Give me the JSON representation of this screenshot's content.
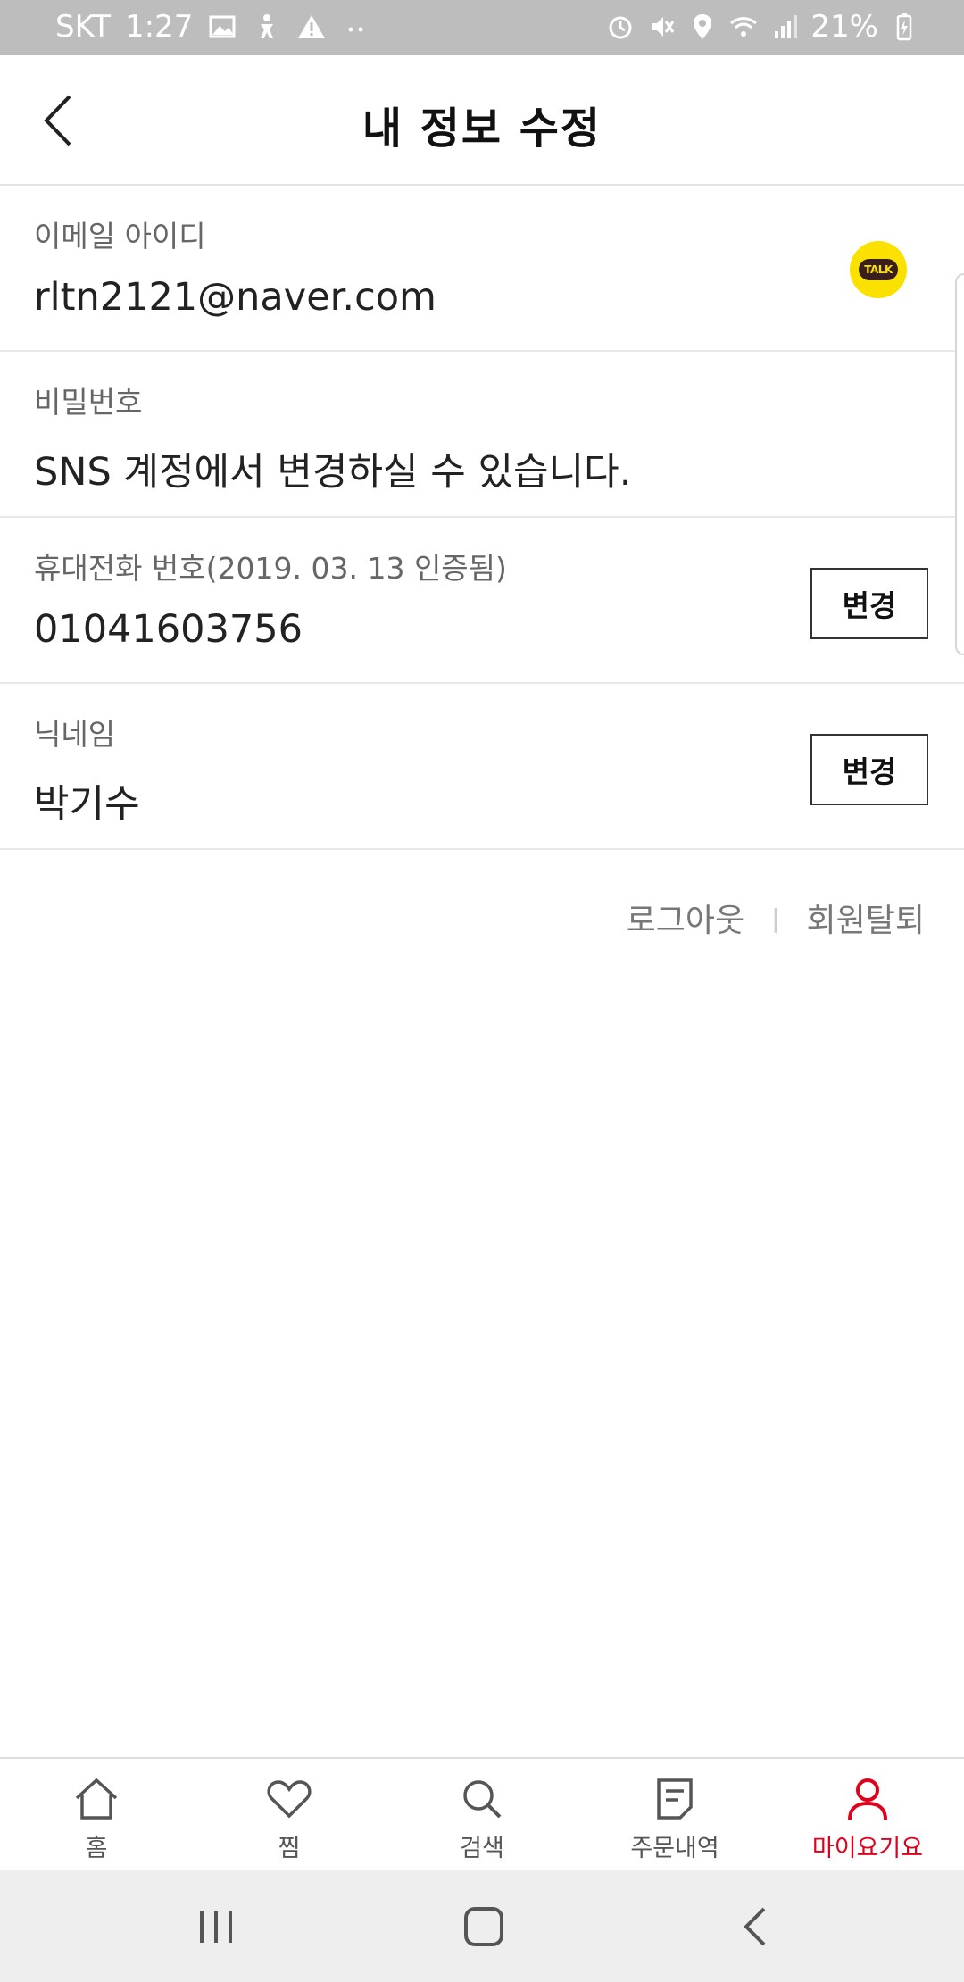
{
  "status_bar": {
    "carrier": "SKT",
    "time": "1:27",
    "battery_percent": "21%",
    "icons_left": [
      "image-icon",
      "accessibility-icon",
      "warning-icon",
      "more-dots-icon"
    ],
    "icons_right": [
      "alarm-icon",
      "mute-icon",
      "location-icon",
      "wifi-icon",
      "signal-icon",
      "battery-charging-icon"
    ]
  },
  "header": {
    "title": "내 정보 수정",
    "back_icon": "chevron-left-icon"
  },
  "fields": {
    "email": {
      "label": "이메일 아이디",
      "value": "rltn2121@naver.com",
      "badge_text": "TALK"
    },
    "password": {
      "label": "비밀번호",
      "value": "SNS 계정에서 변경하실 수 있습니다."
    },
    "phone": {
      "label": "휴대전화 번호(2019. 03. 13 인증됨)",
      "value": "01041603756",
      "button_label": "변경"
    },
    "nickname": {
      "label": "닉네임",
      "value": "박기수",
      "button_label": "변경"
    }
  },
  "links": {
    "logout": "로그아웃",
    "separator": "|",
    "withdraw": "회원탈퇴"
  },
  "bottom_nav": {
    "items": [
      {
        "label": "홈",
        "icon": "home-icon"
      },
      {
        "label": "찜",
        "icon": "heart-icon"
      },
      {
        "label": "검색",
        "icon": "search-icon"
      },
      {
        "label": "주문내역",
        "icon": "receipt-icon"
      },
      {
        "label": "마이요기요",
        "icon": "person-icon",
        "active": true
      }
    ]
  },
  "colors": {
    "accent": "#e0001b",
    "kakao_yellow": "#fae100",
    "status_bar": "#bdbdbd"
  }
}
